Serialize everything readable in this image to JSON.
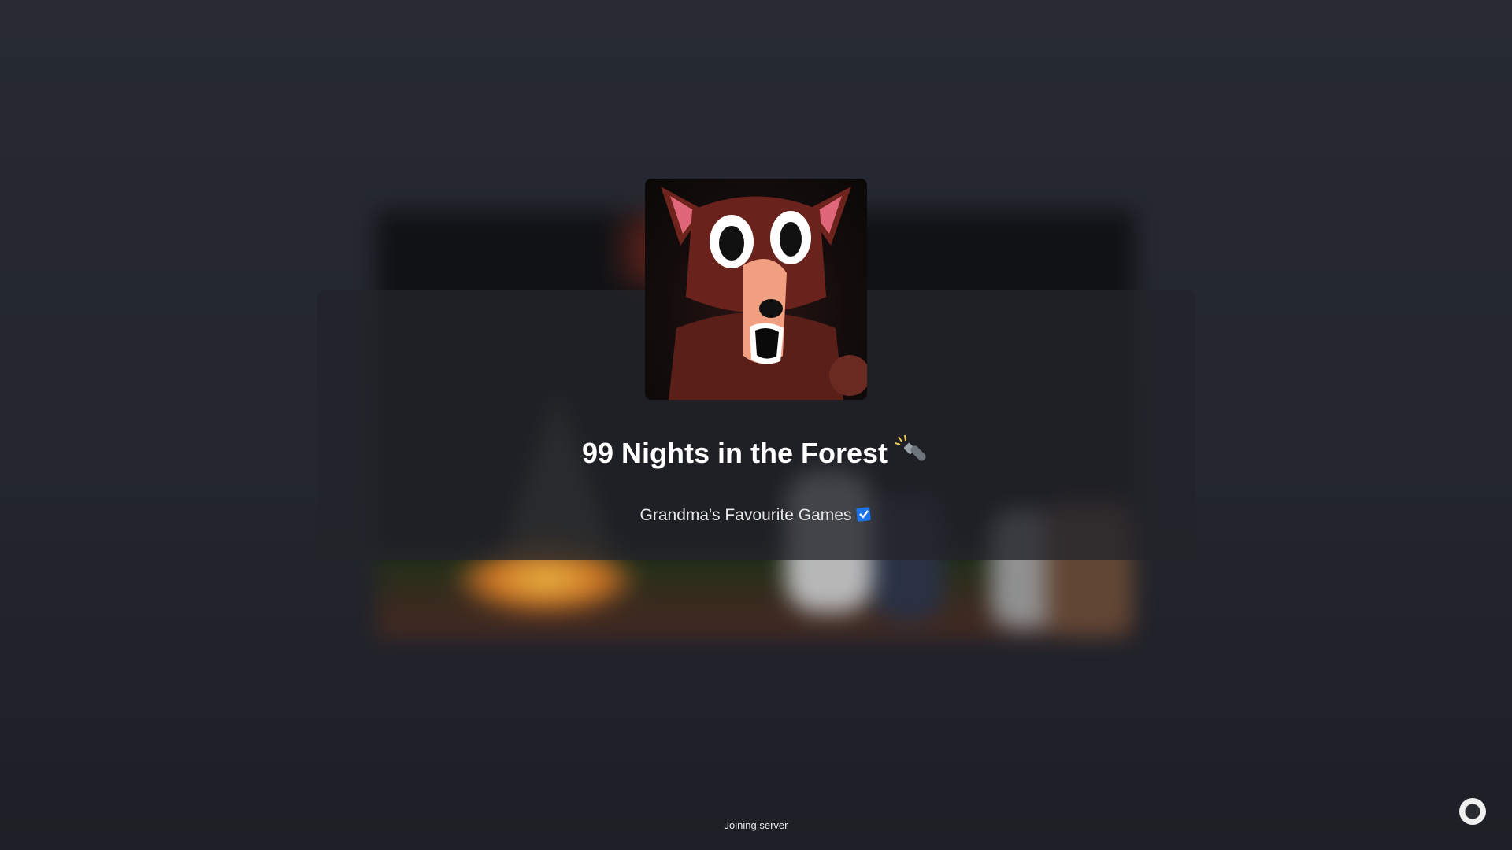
{
  "game": {
    "title": "99 Nights in the Forest",
    "title_icon": "flashlight-icon",
    "creator": "Grandma's Favourite Games",
    "creator_badge": "verified-badge-icon"
  },
  "status": {
    "text": "Joining server",
    "loading_icon": "loading-spinner-icon"
  },
  "colors": {
    "background": "#262932",
    "card": "#22242a",
    "verified_badge": "#1a73e8",
    "text": "#ffffff"
  }
}
